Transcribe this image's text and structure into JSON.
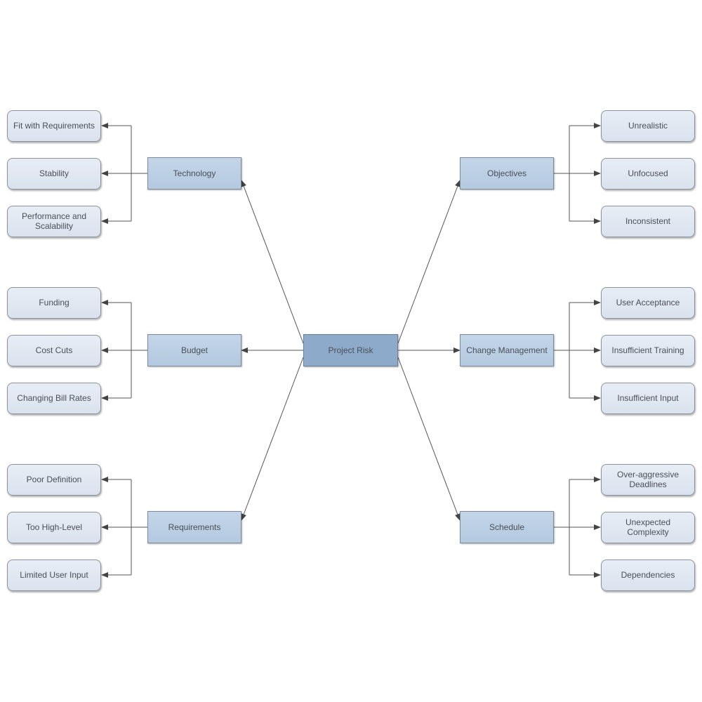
{
  "title": "Project Risk",
  "center": {
    "label": "Project Risk"
  },
  "categories": [
    {
      "label": "Technology",
      "side": "left",
      "children": [
        "Fit with Requirements",
        "Stability",
        "Performance and\nScalability"
      ]
    },
    {
      "label": "Budget",
      "side": "left",
      "children": [
        "Funding",
        "Cost Cuts",
        "Changing Bill Rates"
      ]
    },
    {
      "label": "Requirements",
      "side": "left",
      "children": [
        "Poor Definition",
        "Too High-Level",
        "Limited User Input"
      ]
    },
    {
      "label": "Objectives",
      "side": "right",
      "children": [
        "Unrealistic",
        "Unfocused",
        "Inconsistent"
      ]
    },
    {
      "label": "Change Management",
      "side": "right",
      "children": [
        "User Acceptance",
        "Insufficient Training",
        "Insufficient Input"
      ]
    },
    {
      "label": "Schedule",
      "side": "right",
      "children": [
        "Over-aggressive\nDeadlines",
        "Unexpected\nComplexity",
        "Dependencies"
      ]
    }
  ],
  "colors": {
    "line": "#555555",
    "center_fill": "#8eaacb",
    "category_fill": "#b8cde3",
    "leaf_fill": "#dfe6f0"
  }
}
